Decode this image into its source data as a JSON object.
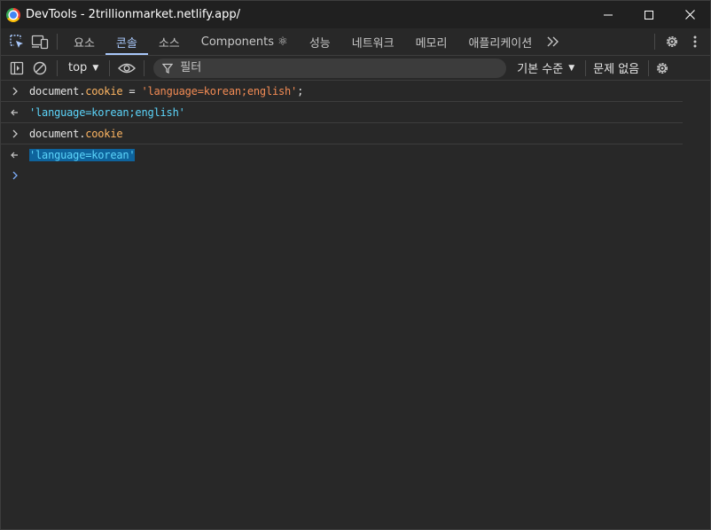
{
  "window": {
    "title": "DevTools - 2trillionmarket.netlify.app/",
    "icon": "chrome-icon"
  },
  "tabs": [
    {
      "label": "요소",
      "active": false
    },
    {
      "label": "콘솔",
      "active": true
    },
    {
      "label": "소스",
      "active": false
    },
    {
      "label": "Components ⚛",
      "active": false
    },
    {
      "label": "성능",
      "active": false
    },
    {
      "label": "네트워크",
      "active": false
    },
    {
      "label": "메모리",
      "active": false
    },
    {
      "label": "애플리케이션",
      "active": false
    }
  ],
  "toolbar": {
    "context": "top",
    "filter_placeholder": "필터",
    "levels": "기본 수준",
    "issues": "문제 없음"
  },
  "console": {
    "line1": {
      "obj": "document",
      "prop": "cookie",
      "op": " = ",
      "str": "'language=korean;english'",
      "end": ";"
    },
    "line2": {
      "str": "'language=korean;english'"
    },
    "line3": {
      "obj": "document",
      "prop": "cookie"
    },
    "line4": {
      "str": "'language=korean'"
    }
  },
  "colors": {
    "accent": "#a8c7fa",
    "background": "#282828",
    "string_input": "#f28b54",
    "string_output": "#5cd5fb",
    "property": "#fdb562",
    "selection": "#0e639c"
  }
}
